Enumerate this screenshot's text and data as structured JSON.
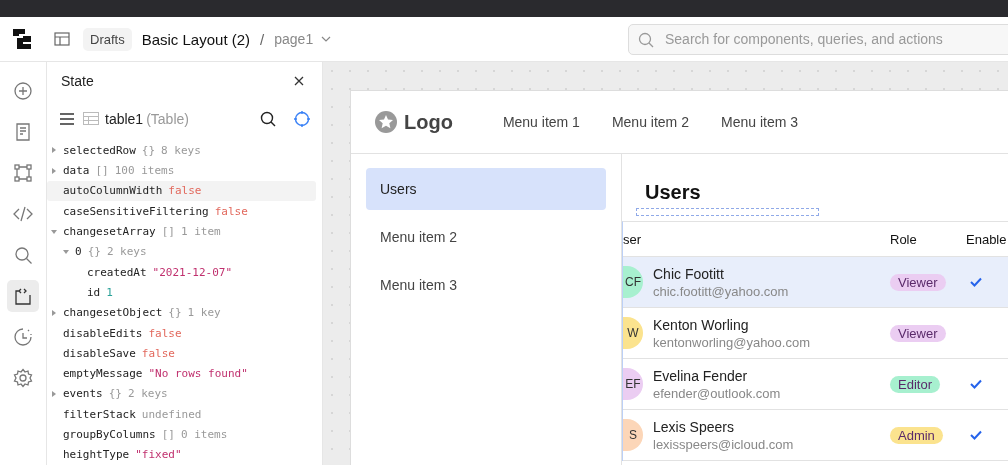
{
  "header": {
    "breadcrumb_folder": "Drafts",
    "app_name": "Basic Layout (2)",
    "separator": "/",
    "page_name": "page1",
    "search": {
      "placeholder": "Search for components, queries, and actions"
    }
  },
  "rail": [
    {
      "selected": false
    },
    {
      "selected": false
    },
    {
      "selected": false
    },
    {
      "selected": false
    },
    {
      "selected": false
    },
    {
      "selected": true
    },
    {
      "selected": false
    },
    {
      "selected": false
    }
  ],
  "state_panel": {
    "title": "State",
    "component_name": "table1",
    "component_type": "(Table)",
    "tree": [
      {
        "key": "selectedRow",
        "brace": "{}",
        "summary": "8 keys",
        "expanded": false,
        "selected": false
      },
      {
        "key": "data",
        "brace": "[]",
        "summary": "100 items",
        "expanded": false,
        "selected": false
      },
      {
        "key": "autoColumnWidth",
        "value": "false",
        "kind": "bool",
        "selected": true
      },
      {
        "key": "caseSensitiveFiltering",
        "value": "false",
        "kind": "bool",
        "selected": false
      },
      {
        "key": "changesetArray",
        "brace": "[]",
        "summary": "1 item",
        "expanded": true,
        "selected": false,
        "children": [
          {
            "key": "0",
            "brace": "{}",
            "summary": "2 keys",
            "expanded": true,
            "selected": false,
            "children": [
              {
                "key": "createdAt",
                "value": "\"2021-12-07\"",
                "kind": "string",
                "selected": false
              },
              {
                "key": "id",
                "value": "1",
                "kind": "number",
                "selected": false
              }
            ]
          }
        ]
      },
      {
        "key": "changesetObject",
        "brace": "{}",
        "summary": "1 key",
        "expanded": false,
        "selected": false
      },
      {
        "key": "disableEdits",
        "value": "false",
        "kind": "bool",
        "selected": false
      },
      {
        "key": "disableSave",
        "value": "false",
        "kind": "bool",
        "selected": false
      },
      {
        "key": "emptyMessage",
        "value": "\"No rows found\"",
        "kind": "string",
        "selected": false
      },
      {
        "key": "events",
        "brace": "{}",
        "summary": "2 keys",
        "expanded": false,
        "selected": false
      },
      {
        "key": "filterStack",
        "value": "undefined",
        "kind": "undefined",
        "selected": false
      },
      {
        "key": "groupByColumns",
        "brace": "[]",
        "summary": "0 items",
        "selected": false
      },
      {
        "key": "heightType",
        "value": "\"fixed\"",
        "kind": "string",
        "selected": false
      }
    ]
  },
  "canvas": {
    "logo": "Logo",
    "top_menu": [
      "Menu item 1",
      "Menu item 2",
      "Menu item 3"
    ],
    "side_menu": [
      {
        "label": "Users",
        "selected": true
      },
      {
        "label": "Menu item 2",
        "selected": false
      },
      {
        "label": "Menu item 3",
        "selected": false
      }
    ],
    "page_title": "Users",
    "table": {
      "columns": [
        "ser",
        "Role",
        "Enable"
      ],
      "rows": [
        {
          "avatar": {
            "initials": "CF",
            "color": "#a7f0cf"
          },
          "name": "Chic Footitt",
          "email": "chic.footitt@yahoo.com",
          "role": {
            "label": "Viewer",
            "color": "#ebcdf2"
          },
          "enabled": true,
          "selected": true
        },
        {
          "avatar": {
            "initials": "W",
            "color": "#fbe38e"
          },
          "name": "Kenton Worling",
          "email": "kentonworling@yahoo.com",
          "role": {
            "label": "Viewer",
            "color": "#ebcdf2"
          },
          "enabled": false,
          "selected": false
        },
        {
          "avatar": {
            "initials": "EF",
            "color": "#ebcdf2"
          },
          "name": "Evelina Fender",
          "email": "efender@outlook.com",
          "role": {
            "label": "Editor",
            "color": "#a7f0cf"
          },
          "enabled": true,
          "selected": false
        },
        {
          "avatar": {
            "initials": "S",
            "color": "#fcd6b8"
          },
          "name": "Lexis Speers",
          "email": "lexisspeers@icloud.com",
          "role": {
            "label": "Admin",
            "color": "#fbe38e"
          },
          "enabled": true,
          "selected": false
        }
      ]
    }
  }
}
